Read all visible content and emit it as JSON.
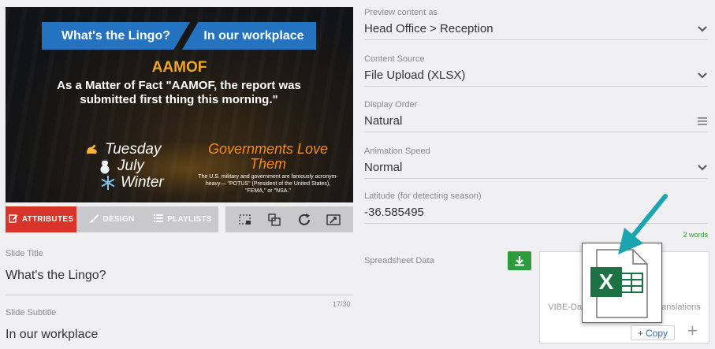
{
  "preview": {
    "banner_left": "What's the Lingo?",
    "banner_right": "In our workplace",
    "acronym": "AAMOF",
    "meaning": "As a Matter of Fact \"AAMOF, the report was submitted first thing this morning.\"",
    "day": "Tuesday",
    "month": "July",
    "season": "Winter",
    "fun_title": "Governments Love Them",
    "fun_text": "The U.S. military and government are famously acronym-heavy— \"POTUS\" (President of the United States), \"FEMA,\" or \"NSA.\""
  },
  "tabs": {
    "attributes": "ATTRIBUTES",
    "design": "DESIGN",
    "playlists": "PLAYLISTS"
  },
  "slide": {
    "title_label": "Slide Title",
    "title_value": "What's the Lingo?",
    "subtitle_label": "Slide Subtitle",
    "subtitle_value": "In our workplace",
    "subtitle_counter": "17/30"
  },
  "form": {
    "preview_label": "Preview content as",
    "preview_value": "Head Office > Reception",
    "source_label": "Content Source",
    "source_value": "File Upload (XLSX)",
    "order_label": "Display Order",
    "order_value": "Natural",
    "speed_label": "Animation Speed",
    "speed_value": "Normal",
    "latitude_label": "Latitude (for detecting season)",
    "latitude_value": "-36.585495",
    "word_count": "2 words",
    "spreadsheet_label": "Spreadsheet Data"
  },
  "dropzone": {
    "file_text_left": "VIBE-Da",
    "file_text_right": "anslations",
    "copy_label": "Copy",
    "plus": "+"
  },
  "colors": {
    "accent_red": "#d8342a",
    "banner_blue": "#2473c1",
    "acronym_orange": "#f5a623",
    "download_green": "#2b9c3c",
    "arrow_teal": "#1aa5b0",
    "excel_green": "#1e7145"
  }
}
